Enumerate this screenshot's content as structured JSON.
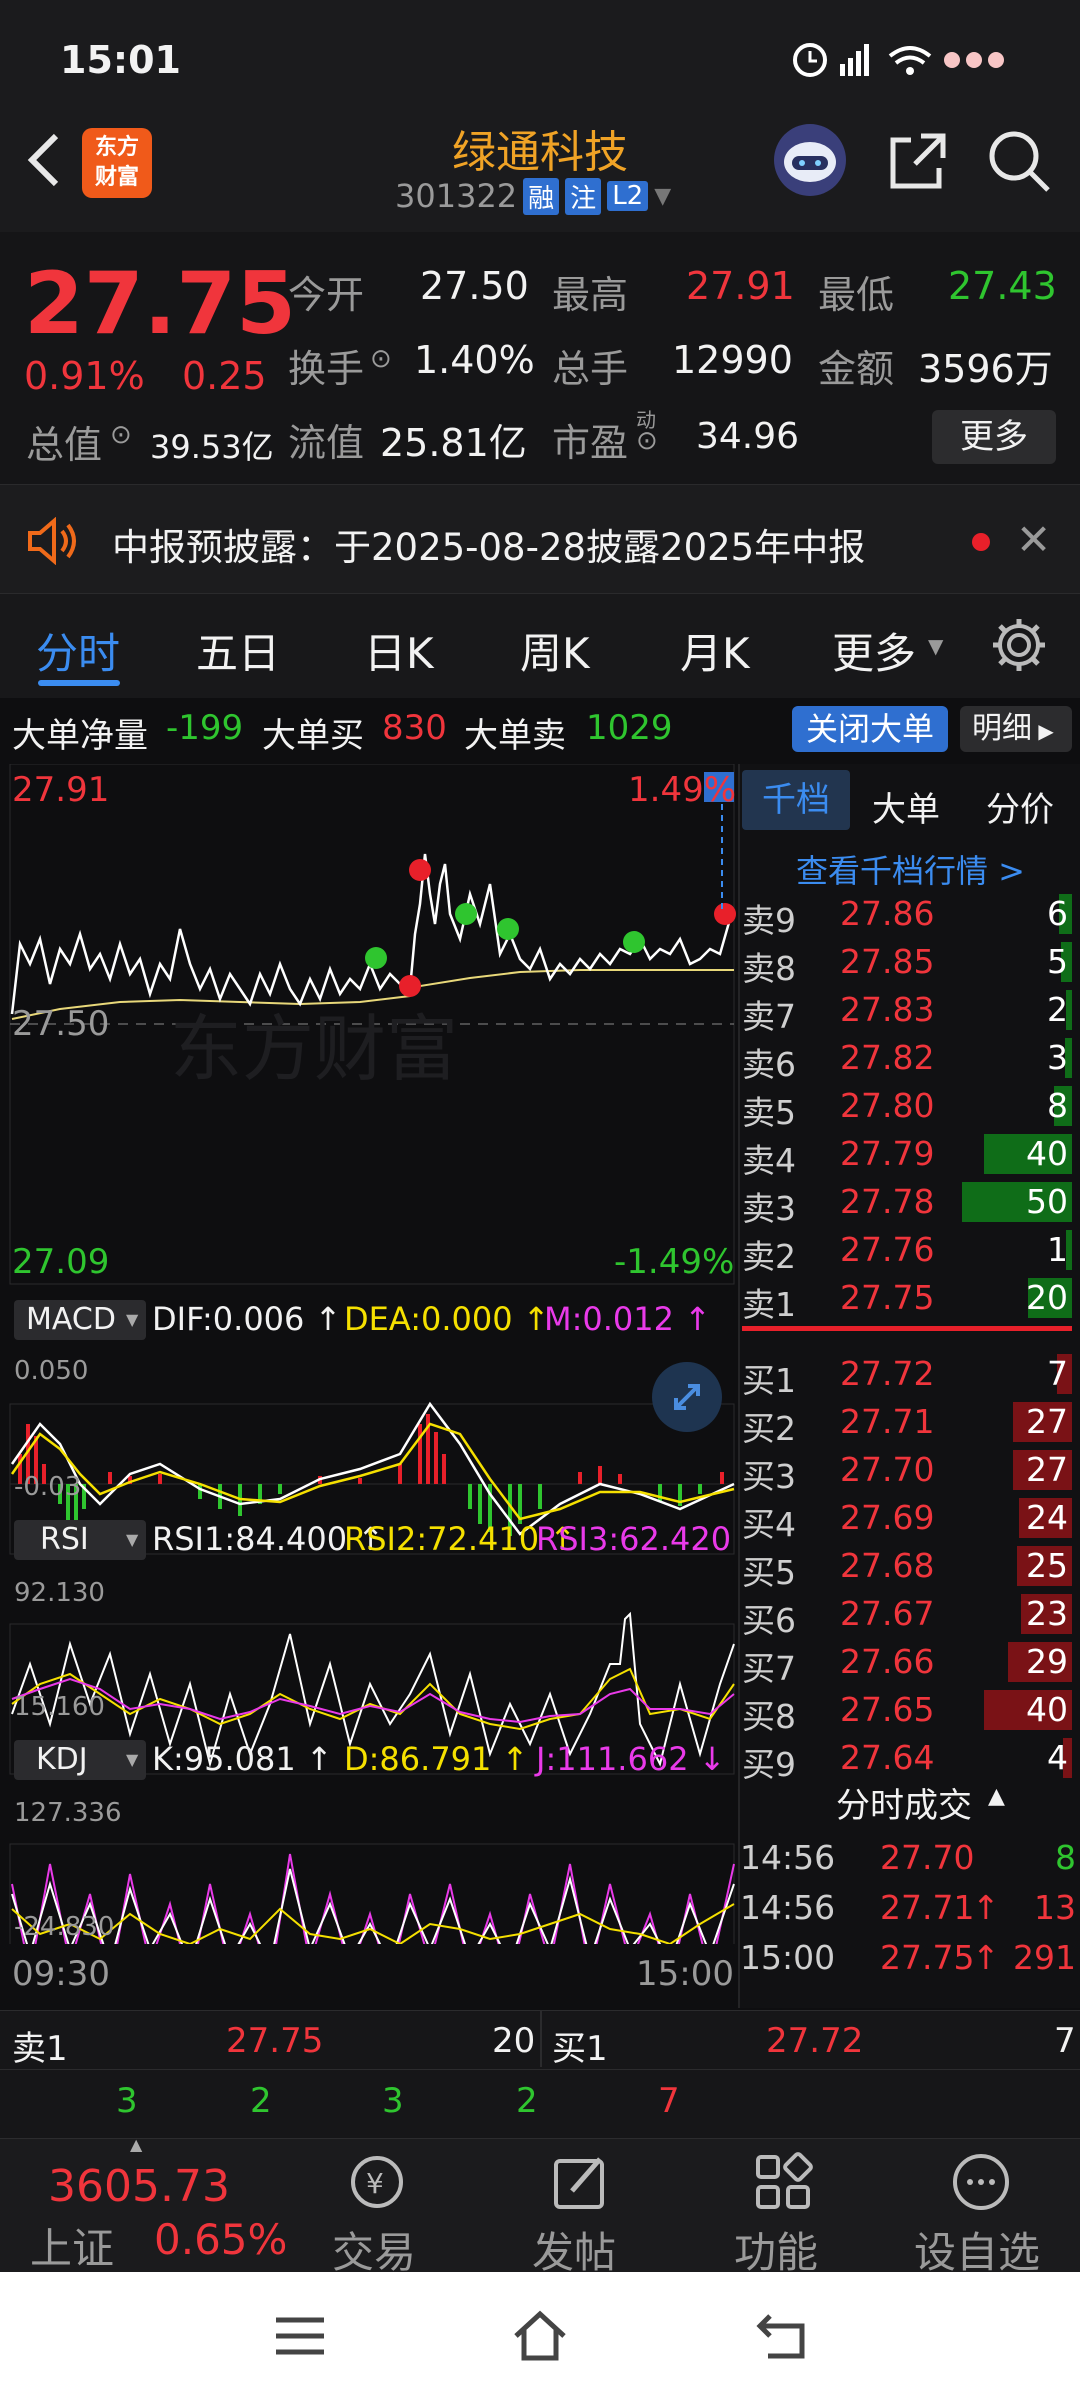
{
  "status": {
    "time": "15:01"
  },
  "header": {
    "title": "绿通科技",
    "code": "301322",
    "badges": [
      "融",
      "注",
      "L2"
    ],
    "logo_text": "东方\n财富"
  },
  "quote": {
    "price": "27.75",
    "change_pct": "0.91%",
    "change": "0.25",
    "open_label": "今开",
    "open": "27.50",
    "high_label": "最高",
    "high": "27.91",
    "low_label": "最低",
    "low": "27.43",
    "turnover_label": "换手",
    "turnover": "1.40%",
    "volume_label": "总手",
    "volume": "12990",
    "amount_label": "金额",
    "amount": "3596万",
    "mktcap_label": "总值",
    "mktcap": "39.53亿",
    "float_label": "流值",
    "float_cap": "25.81亿",
    "pe_label": "市盈",
    "pe_sup": "动",
    "pe": "34.96",
    "more": "更多"
  },
  "notice": {
    "text": "中报预披露：于2025-08-28披露2025年中报"
  },
  "tabs": [
    "分时",
    "五日",
    "日K",
    "周K",
    "月K",
    "更多"
  ],
  "bigorder": {
    "net_label": "大单净量",
    "net": "-199",
    "buy_label": "大单买",
    "buy": "830",
    "sell_label": "大单卖",
    "sell": "1029",
    "close_btn": "关闭大单",
    "detail_btn": "明细"
  },
  "intraday": {
    "top_price": "27.91",
    "top_pct": "1.49%",
    "mid_price": "27.50",
    "bot_price": "27.09",
    "bot_pct": "-1.49%",
    "watermark": "东方财富"
  },
  "macd": {
    "name": "MACD",
    "dif": "DIF:0.006",
    "dea": "DEA:0.000",
    "m": "M:0.012",
    "top": "0.050",
    "bot": "-0.03"
  },
  "rsi": {
    "name": "RSI",
    "rsi1": "RSI1:84.400",
    "rsi2": "RSI2:72.410",
    "rsi3": "RSI3:62.420",
    "top": "92.130",
    "bot": "15.160"
  },
  "kdj": {
    "name": "KDJ",
    "k": "K:95.081",
    "d": "D:86.791",
    "j": "J:111.662",
    "top": "127.336",
    "bot": "-24.830"
  },
  "time_axis": {
    "start": "09:30",
    "end": "15:00"
  },
  "orderbook": {
    "tabs": [
      "千档",
      "大单",
      "分价"
    ],
    "link": "查看千档行情 >",
    "sells": [
      {
        "label": "卖9",
        "price": "27.86",
        "vol": "6",
        "vol_num": 6
      },
      {
        "label": "卖8",
        "price": "27.85",
        "vol": "5",
        "vol_num": 5
      },
      {
        "label": "卖7",
        "price": "27.83",
        "vol": "2",
        "vol_num": 2
      },
      {
        "label": "卖6",
        "price": "27.82",
        "vol": "3",
        "vol_num": 3
      },
      {
        "label": "卖5",
        "price": "27.80",
        "vol": "8",
        "vol_num": 8
      },
      {
        "label": "卖4",
        "price": "27.79",
        "vol": "40",
        "vol_num": 40
      },
      {
        "label": "卖3",
        "price": "27.78",
        "vol": "50",
        "vol_num": 50
      },
      {
        "label": "卖2",
        "price": "27.76",
        "vol": "1",
        "vol_num": 1
      },
      {
        "label": "卖1",
        "price": "27.75",
        "vol": "20",
        "vol_num": 20
      }
    ],
    "buys": [
      {
        "label": "买1",
        "price": "27.72",
        "vol": "7",
        "vol_num": 7
      },
      {
        "label": "买2",
        "price": "27.71",
        "vol": "27",
        "vol_num": 27
      },
      {
        "label": "买3",
        "price": "27.70",
        "vol": "27",
        "vol_num": 27
      },
      {
        "label": "买4",
        "price": "27.69",
        "vol": "24",
        "vol_num": 24
      },
      {
        "label": "买5",
        "price": "27.68",
        "vol": "25",
        "vol_num": 25
      },
      {
        "label": "买6",
        "price": "27.67",
        "vol": "23",
        "vol_num": 23
      },
      {
        "label": "买7",
        "price": "27.66",
        "vol": "29",
        "vol_num": 29
      },
      {
        "label": "买8",
        "price": "27.65",
        "vol": "40",
        "vol_num": 40
      },
      {
        "label": "买9",
        "price": "27.64",
        "vol": "4",
        "vol_num": 4
      }
    ],
    "ticks_title": "分时成交",
    "ticks": [
      {
        "time": "14:56",
        "price": "27.70",
        "arrow": "",
        "vol": "8",
        "color": "green"
      },
      {
        "time": "14:56",
        "price": "27.71",
        "arrow": "↑",
        "vol": "13",
        "color": "red"
      },
      {
        "time": "15:00",
        "price": "27.75",
        "arrow": "↑",
        "vol": "291",
        "color": "red"
      }
    ]
  },
  "level1": {
    "sell_label": "卖1",
    "sell_price": "27.75",
    "sell_vol": "20",
    "buy_label": "买1",
    "buy_price": "27.72",
    "buy_vol": "7",
    "sell_queue": [
      "3",
      "2",
      "3",
      "2"
    ],
    "buy_queue": [
      "7"
    ]
  },
  "bottomnav": {
    "index_value": "3605.73",
    "index_name": "上证",
    "index_pct": "0.65%",
    "items": [
      "交易",
      "发帖",
      "功能",
      "设自选"
    ]
  }
}
